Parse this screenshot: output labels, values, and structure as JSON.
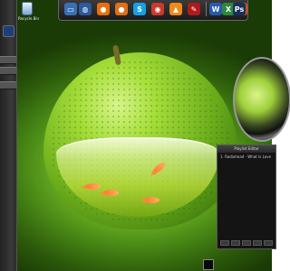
{
  "desktop": {
    "recycle_bin_label": "Recycle Bin"
  },
  "left_panel": {
    "strips": [
      "",
      "",
      ""
    ]
  },
  "dock": {
    "icons": [
      {
        "name": "monitor-icon",
        "glyph": "▭",
        "color": "#3a6fb5"
      },
      {
        "name": "network-icon",
        "glyph": "◍",
        "color": "#2c5a9a"
      },
      {
        "name": "firefox-icon",
        "glyph": "●",
        "color": "#e8700a"
      },
      {
        "name": "basketball-icon",
        "glyph": "●",
        "color": "#e0701a"
      },
      {
        "name": "skype-icon",
        "glyph": "S",
        "color": "#1aa0e0"
      },
      {
        "name": "chrome-icon",
        "glyph": "◉",
        "color": "#cc3a2a"
      },
      {
        "name": "vlc-icon",
        "glyph": "▲",
        "color": "#f08a1a"
      },
      {
        "name": "paint-icon",
        "glyph": "✎",
        "color": "#b01a1a"
      },
      {
        "name": "word-icon",
        "glyph": "W",
        "color": "#2a5aa8"
      },
      {
        "name": "excel-icon",
        "glyph": "X",
        "color": "#2a8a3a"
      },
      {
        "name": "powerpoint-icon",
        "glyph": "P",
        "color": "#d0501a"
      },
      {
        "name": "photoshop-icon",
        "glyph": "Ps",
        "color": "#1a2f5a"
      }
    ]
  },
  "playlist": {
    "title": "Playlist Editor",
    "tracks": [
      "1. Radiohead - What Is Love"
    ]
  }
}
